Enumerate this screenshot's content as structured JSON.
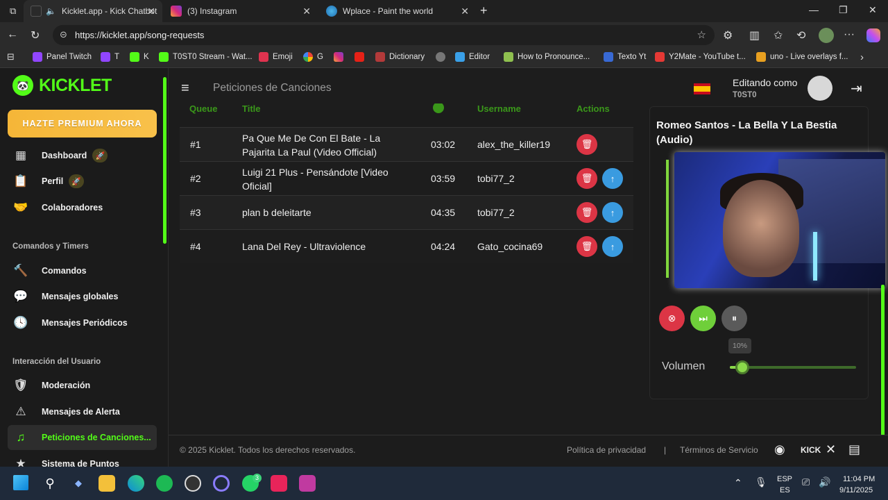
{
  "browser": {
    "tabs": [
      {
        "title": "Kicklet.app - Kick Chatbot ar",
        "active": true
      },
      {
        "title": "(3) Instagram",
        "active": false
      },
      {
        "title": "Wplace - Paint the world",
        "active": false
      }
    ],
    "url": "https://kicklet.app/song-requests",
    "bookmarks": [
      "Panel Twitch",
      "T",
      "K",
      "T0ST0 Stream - Wat...",
      "Emoji",
      "G",
      "Dictionary",
      "Editor",
      "How to Pronounce...",
      "Texto Yt",
      "Y2Mate - YouTube t...",
      "uno - Live overlays f..."
    ]
  },
  "sidebar": {
    "logo": "KICKLET",
    "premium": "HAZTE PREMIUM AHORA",
    "nav_main": [
      {
        "label": "Dashboard"
      },
      {
        "label": "Perfil"
      },
      {
        "label": "Colaboradores"
      }
    ],
    "section_commands": "Comandos y Timers",
    "nav_commands": [
      {
        "label": "Comandos"
      },
      {
        "label": "Mensajes globales"
      },
      {
        "label": "Mensajes Periódicos"
      }
    ],
    "section_interaction": "Interacción del Usuario",
    "nav_interaction": [
      {
        "label": "Moderación"
      },
      {
        "label": "Mensajes de Alerta"
      },
      {
        "label": "Peticiones de Canciones..."
      },
      {
        "label": "Sistema de Puntos"
      }
    ]
  },
  "header": {
    "title": "Peticiones de Canciones",
    "editing_label": "Editando como",
    "user": "T0ST0"
  },
  "table": {
    "columns": [
      "Queue",
      "Title",
      "",
      "Username",
      "Actions"
    ],
    "rows": [
      {
        "pos": "#1",
        "title": "Pa Que Me De Con El Bate - La Pajarita La Paul (Video Official)",
        "duration": "03:02",
        "user": "alex_the_killer19"
      },
      {
        "pos": "#2",
        "title": "Luigi 21 Plus - Pensándote [Video Oficial]",
        "duration": "03:59",
        "user": "tobi77_2"
      },
      {
        "pos": "#3",
        "title": "plan b deleitarte",
        "duration": "04:35",
        "user": "tobi77_2"
      },
      {
        "pos": "#4",
        "title": "Lana Del Rey - Ultraviolence",
        "duration": "04:24",
        "user": "Gato_cocina69"
      }
    ]
  },
  "player": {
    "now_playing": "Romeo Santos - La Bella Y La Bestia (Audio)",
    "volume_label": "Volumen",
    "volume_value": "10%",
    "volume_fraction": 0.1
  },
  "footer": {
    "copyright": "© 2025 Kicklet. Todos los derechos reservados.",
    "privacy": "Política de privacidad",
    "separator": "|",
    "terms": "Términos de Servicio"
  },
  "taskbar": {
    "lang_top": "ESP",
    "lang_bottom": "ES",
    "time": "11:04 PM",
    "date": "9/11/2025",
    "whatsapp_badge": "3"
  },
  "colors": {
    "accent": "#53fc18",
    "delete": "#dc3545",
    "up": "#3a9be0",
    "premium": "#f5b638"
  }
}
